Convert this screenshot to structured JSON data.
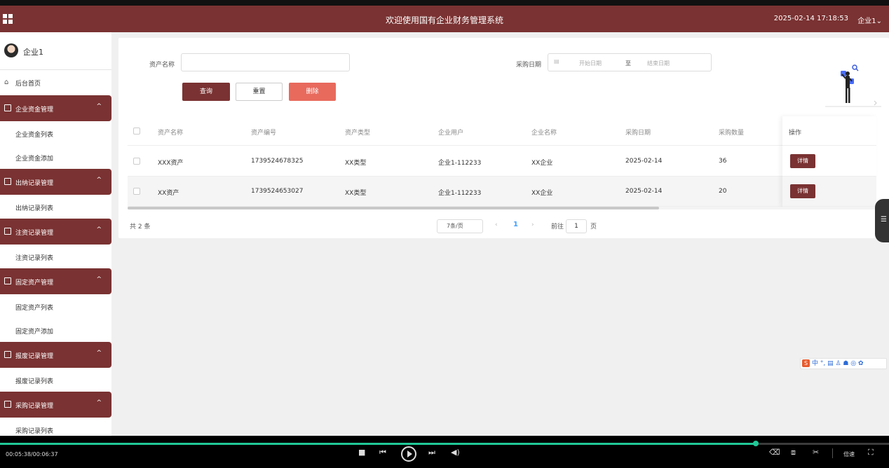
{
  "header": {
    "title": "欢迎使用国有企业财务管理系统",
    "datetime": "2025-02-14 17:18:53",
    "user": "企业1⌄",
    "colors": {
      "primary": "#7a3232"
    }
  },
  "sidebar": {
    "user": "企业1",
    "home": "后台首页",
    "groups": [
      {
        "label": "企业资金管理",
        "items": [
          "企业资金列表",
          "企业资金添加"
        ]
      },
      {
        "label": "出纳记录管理",
        "items": [
          "出纳记录列表"
        ]
      },
      {
        "label": "注资记录管理",
        "items": [
          "注资记录列表"
        ]
      },
      {
        "label": "固定资产管理",
        "items": [
          "固定资产列表",
          "固定资产添加"
        ]
      },
      {
        "label": "报废记录管理",
        "items": [
          "报废记录列表"
        ]
      },
      {
        "label": "采购记录管理",
        "items": [
          "采购记录列表"
        ]
      }
    ]
  },
  "search": {
    "asset_name_label": "资产名称",
    "asset_name_value": "",
    "date_label": "采购日期",
    "start_placeholder": "开始日期",
    "to": "至",
    "end_placeholder": "结束日期",
    "query": "查询",
    "reset": "重置",
    "delete": "删除"
  },
  "table": {
    "columns": [
      "资产名称",
      "资产编号",
      "资产类型",
      "企业用户",
      "企业名称",
      "采购日期",
      "采购数量",
      "操作"
    ],
    "rows": [
      {
        "name": "XXX资产",
        "code": "1739524678325",
        "type": "XX类型",
        "user": "企业1-112233",
        "company": "XX企业",
        "date": "2025-02-14",
        "qty": "36",
        "action": "详情"
      },
      {
        "name": "XX资产",
        "code": "1739524653027",
        "type": "XX类型",
        "user": "企业1-112233",
        "company": "XX企业",
        "date": "2025-02-14",
        "qty": "20",
        "action": "详情"
      }
    ]
  },
  "pagination": {
    "total": "共 2 条",
    "page_size": "7条/页",
    "prev": "‹",
    "current": "1",
    "next": "›",
    "goto_label": "前往",
    "goto_value": "1",
    "page_suffix": "页"
  },
  "ime": {
    "logo": "S",
    "chars": "中 °, ▤ ♙ ☗ ◎ ✿"
  },
  "player": {
    "time": "00:05:38/00:06:37",
    "progress": 0.85,
    "speed": "倍速"
  }
}
